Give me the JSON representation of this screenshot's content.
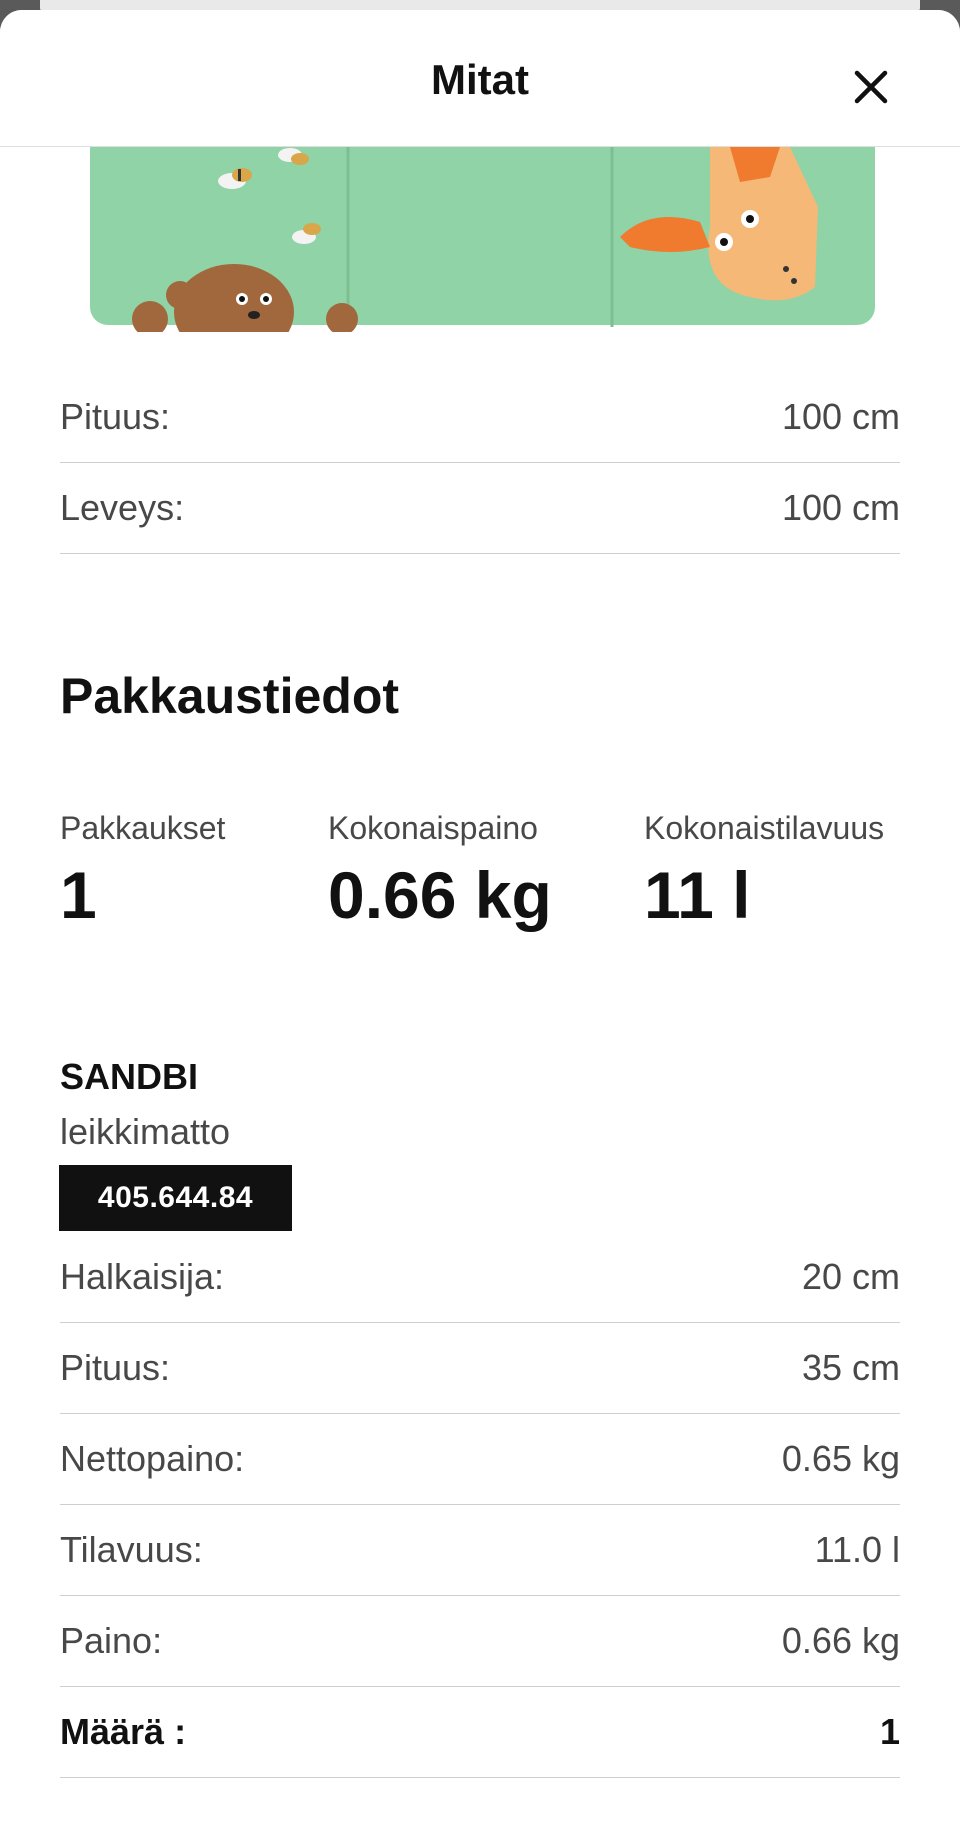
{
  "header": {
    "title": "Mitat"
  },
  "dimensions": [
    {
      "label": "Pituus:",
      "value": "100 cm"
    },
    {
      "label": "Leveys:",
      "value": "100 cm"
    }
  ],
  "packaging": {
    "title": "Pakkaustiedot",
    "summary": [
      {
        "label": "Pakkaukset",
        "value": "1"
      },
      {
        "label": "Kokonaispaino",
        "value": "0.66 kg"
      },
      {
        "label": "Kokonaistilavuus",
        "value": "11 l"
      }
    ]
  },
  "product": {
    "name": "SANDBI",
    "description": "leikkimatto",
    "article_number": "405.644.84",
    "specs": [
      {
        "label": "Halkaisija:",
        "value": "20 cm"
      },
      {
        "label": "Pituus:",
        "value": "35 cm"
      },
      {
        "label": "Nettopaino:",
        "value": "0.65 kg"
      },
      {
        "label": "Tilavuus:",
        "value": "11.0 l"
      },
      {
        "label": "Paino:",
        "value": "0.66 kg"
      }
    ],
    "quantity": {
      "label": "Määrä :",
      "value": "1"
    }
  },
  "colors": {
    "mat_green": "#8fd3a6",
    "bear_brown": "#a0683c",
    "moose_orange": "#f5a85c",
    "badge_black": "#111111"
  }
}
